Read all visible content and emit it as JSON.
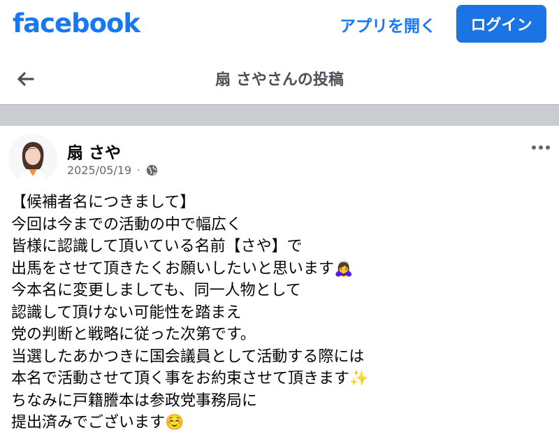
{
  "header": {
    "logo": "facebook",
    "open_app_label": "アプリを開く",
    "login_label": "ログイン"
  },
  "nav": {
    "title": "扇 さやさんの投稿"
  },
  "post": {
    "author": "扇 さや",
    "date": "2025/05/19",
    "separator": "·",
    "lines": [
      "【候補者名につきまして】",
      "今回は今までの活動の中で幅広く",
      "皆様に認識して頂いている名前【さや】で",
      "出馬をさせて頂きたくお願いしたいと思います🙇‍♀️",
      "今本名に変更しましても、同一人物として",
      "認識して頂けない可能性を踏まえ",
      "党の判断と戦略に従った次第です。",
      "当選したあかつきに国会議員として活動する際には",
      "本名で活動させて頂く事をお約束させて頂きます✨",
      "ちなみに戸籍謄本は参政党事務局に",
      "提出済みでございます☺️"
    ]
  },
  "colors": {
    "brand": "#1877f2",
    "button": "#1b74e4",
    "band": "#c9ccd1"
  }
}
